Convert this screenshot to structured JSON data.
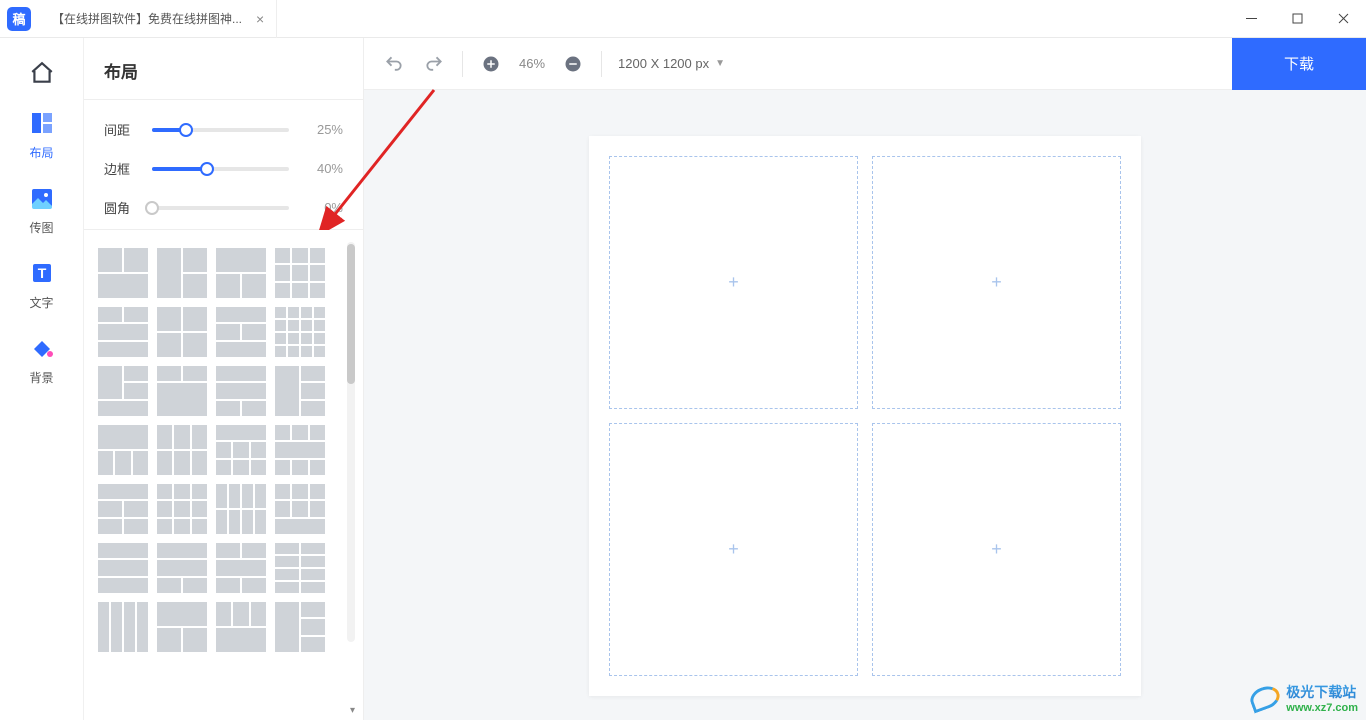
{
  "app_badge": "稿",
  "tab": {
    "title": "【在线拼图软件】免费在线拼图神...",
    "close": "×"
  },
  "rail": {
    "home": {
      "label": ""
    },
    "layout": {
      "label": "布局"
    },
    "upload": {
      "label": "传图"
    },
    "text": {
      "label": "文字"
    },
    "bg": {
      "label": "背景"
    }
  },
  "panel": {
    "title": "布局",
    "sliders": {
      "spacing": {
        "label": "间距",
        "value_text": "25%",
        "pct": 25
      },
      "border": {
        "label": "边框",
        "value_text": "40%",
        "pct": 40
      },
      "radius": {
        "label": "圆角",
        "value_text": "0%",
        "pct": 0
      }
    }
  },
  "toolbar": {
    "zoom_text": "46%",
    "canvas_size_text": "1200 X 1200 px",
    "download_label": "下载"
  },
  "watermark": {
    "line1": "极光下载站",
    "line2": "www.xz7.com"
  },
  "cell_plus": "+"
}
